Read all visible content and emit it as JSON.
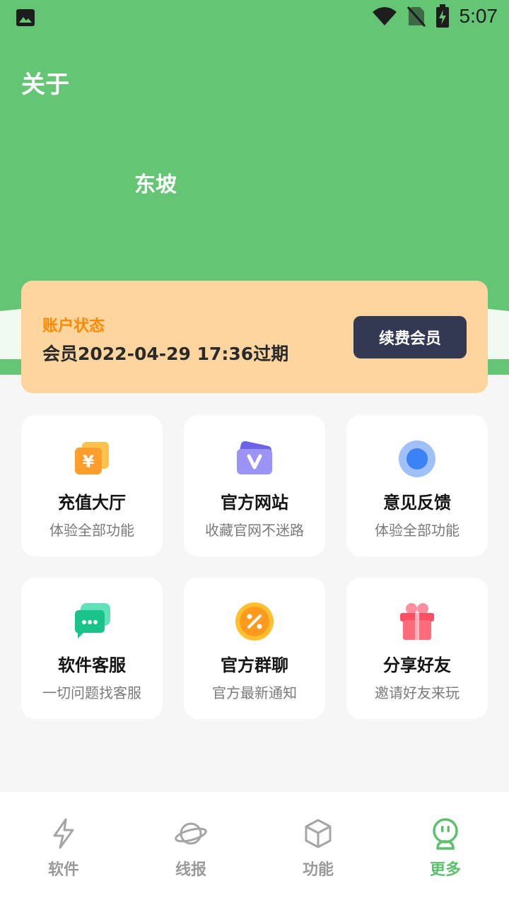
{
  "status_bar": {
    "time": "5:07"
  },
  "page": {
    "title": "关于"
  },
  "user": {
    "name": "东坡"
  },
  "account": {
    "label": "账户状态",
    "status": "会员2022-04-29 17:36过期",
    "renew_label": "续费会员"
  },
  "features": [
    {
      "title": "充值大厅",
      "subtitle": "体验全部功能",
      "icon": "yuan-coupon-icon"
    },
    {
      "title": "官方网站",
      "subtitle": "收藏官网不迷路",
      "icon": "v-card-icon"
    },
    {
      "title": "意见反馈",
      "subtitle": "体验全部功能",
      "icon": "circle-dot-icon"
    },
    {
      "title": "软件客服",
      "subtitle": "一切问题找客服",
      "icon": "chat-bubble-icon"
    },
    {
      "title": "官方群聊",
      "subtitle": "官方最新通知",
      "icon": "percent-coin-icon"
    },
    {
      "title": "分享好友",
      "subtitle": "邀请好友来玩",
      "icon": "gift-icon"
    }
  ],
  "nav": [
    {
      "label": "软件",
      "icon": "lightning-icon",
      "active": false
    },
    {
      "label": "线报",
      "icon": "planet-icon",
      "active": false
    },
    {
      "label": "功能",
      "icon": "cube-icon",
      "active": false
    },
    {
      "label": "更多",
      "icon": "robot-face-icon",
      "active": true
    }
  ],
  "colors": {
    "header_green": "#64c574",
    "card_orange": "#ffd59f",
    "accent_orange": "#ff8a00",
    "button_navy": "#333853",
    "nav_active": "#5cc06d"
  }
}
